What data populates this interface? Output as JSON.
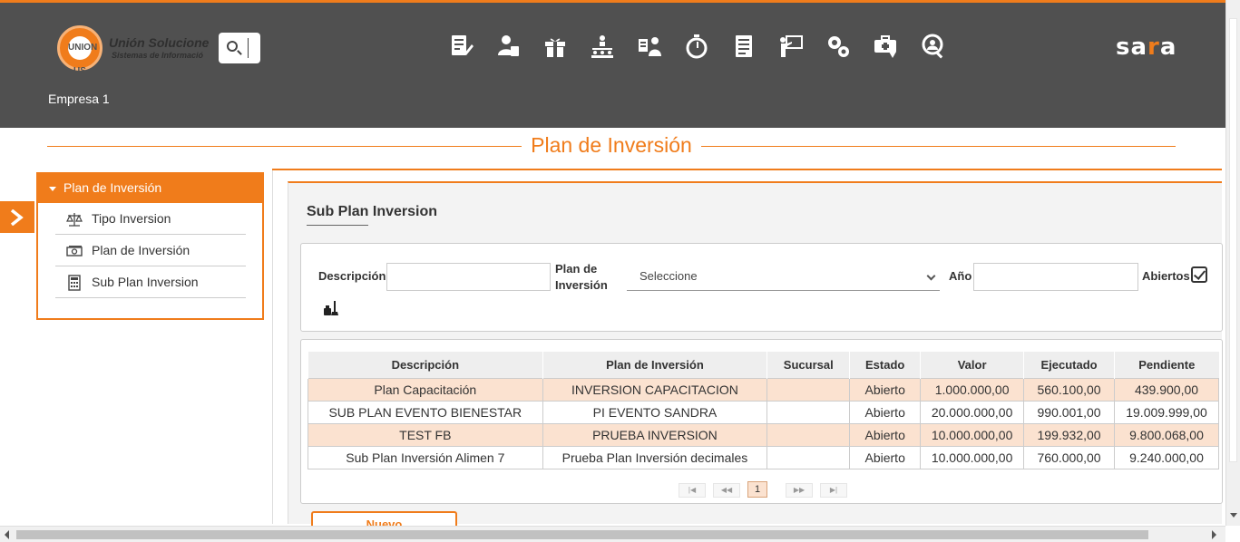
{
  "header": {
    "logo_text": "UNION US",
    "brand_name": "Unión Solucione",
    "brand_sub": "Sistemas de Informació",
    "company": "Empresa 1",
    "app_logo": "sara",
    "nav_icons": [
      "document-edit-icon",
      "user-clipboard-icon",
      "gift-icon",
      "hierarchy-icon",
      "user-list-icon",
      "stopwatch-icon",
      "form-icon",
      "presentation-icon",
      "gears-icon",
      "medical-bag-icon",
      "user-search-icon"
    ]
  },
  "page": {
    "title": "Plan de Inversión"
  },
  "sidebar": {
    "header": "Plan de Inversión",
    "items": [
      {
        "label": "Tipo Inversion",
        "icon": "scale-icon"
      },
      {
        "label": "Plan de Inversión",
        "icon": "money-icon"
      },
      {
        "label": "Sub Plan Inversion",
        "icon": "calculator-icon"
      }
    ]
  },
  "main": {
    "section_title": "Sub Plan Inversion",
    "filters": {
      "descripcion_label": "Descripción",
      "descripcion_value": "",
      "plan_label": "Plan de Inversión",
      "plan_value": "Seleccione",
      "anio_label": "Año",
      "anio_value": "",
      "abiertos_label": "Abiertos",
      "abiertos_checked": true
    },
    "table": {
      "columns": [
        "Descripción",
        "Plan de Inversión",
        "Sucursal",
        "Estado",
        "Valor",
        "Ejecutado",
        "Pendiente"
      ],
      "rows": [
        [
          "Plan Capacitación",
          "INVERSION CAPACITACION",
          "",
          "Abierto",
          "1.000.000,00",
          "560.100,00",
          "439.900,00"
        ],
        [
          "SUB PLAN EVENTO BIENESTAR",
          "PI EVENTO SANDRA",
          "",
          "Abierto",
          "20.000.000,00",
          "990.001,00",
          "19.009.999,00"
        ],
        [
          "TEST FB",
          "PRUEBA INVERSION",
          "",
          "Abierto",
          "10.000.000,00",
          "199.932,00",
          "9.800.068,00"
        ],
        [
          "Sub Plan Inversión Alimen 7",
          "Prueba Plan Inversión decimales",
          "",
          "Abierto",
          "10.000.000,00",
          "760.000,00",
          "9.240.000,00"
        ]
      ]
    },
    "pager": {
      "first": "|◀",
      "prev": "◀◀",
      "current": "1",
      "next": "▶▶",
      "last": "▶|"
    },
    "new_button": "Nuevo"
  },
  "colors": {
    "accent": "#f07c1b",
    "header_bg": "#505050",
    "row_alt": "#fbe2d0"
  }
}
